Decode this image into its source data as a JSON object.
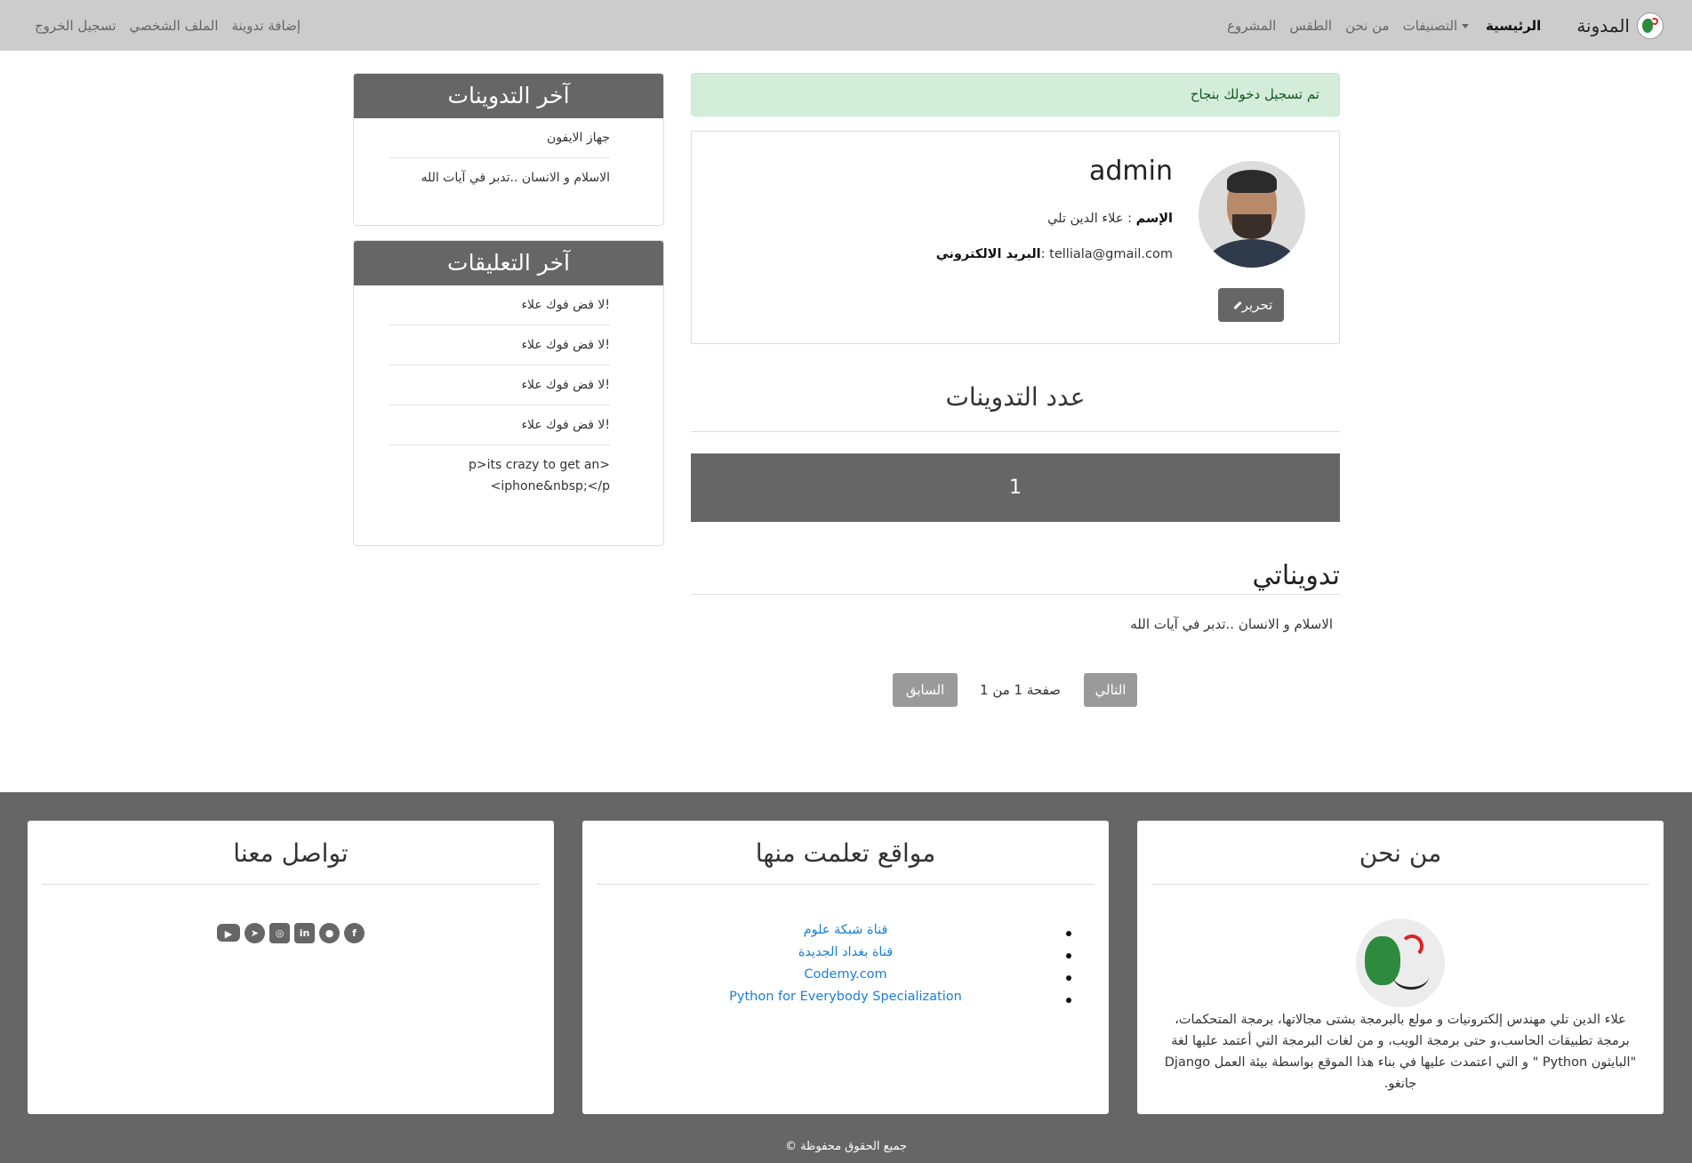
{
  "nav": {
    "brand": "المدونة",
    "home": "الرئيسية",
    "categories": "التصنيفات",
    "about": "من نحن",
    "weather": "الطقس",
    "project": "المشروع",
    "add_post": "إضافة تدوينة",
    "profile": "الملف الشخصي",
    "logout": "تسجيل الخروج"
  },
  "sidebar": {
    "recent_posts_title": "آخر التدوينات",
    "recent_posts": [
      "جهاز الايفون",
      "الاسلام و الانسان ..تدبر في آيات الله"
    ],
    "recent_comments_title": "آخر التعليقات",
    "recent_comments": [
      "لا فض فوك علاء!",
      "لا فض فوك علاء!",
      "لا فض فوك علاء!",
      "لا فض فوك علاء!",
      "p>its crazy to get an> <iphone&nbsp;</p"
    ]
  },
  "alert": "تم تسجيل دخولك بنجاح",
  "profile": {
    "username": "admin",
    "name_label": "الإسم",
    "name_value": "علاء الدين تلي",
    "email_label": "البريد الالكتروني",
    "email_value": "telliala@gmail.com",
    "edit_label": "تحرير"
  },
  "stats": {
    "title": "عدد التدوينات",
    "count": "1"
  },
  "my_posts": {
    "title": "تدويناتي",
    "items": [
      "الاسلام و الانسان ..تدبر في آيات الله"
    ]
  },
  "pagination": {
    "next": "التالي",
    "info": "صفحة 1 من 1",
    "prev": "السابق"
  },
  "footer": {
    "about_title": "من نحن",
    "about_text": "علاء الدين تلي مهندس إلكترونيات و مولع بالبرمجة بشتى مجالاتها، برمجة المتحكمات، برمجة تطبيقات الحاسب،و حتى برمجة الويب، و من لغات البرمجة التي أعتمد عليها لغة \"البايثون Python \" و التي اعتمدت عليها في بناء هذا الموقع بواسطة بيئة العمل Django جانغو.",
    "learn_title": "مواقع تعلمت منها",
    "learn_links": [
      "قناة شبكة علوم",
      "قناة بغداد الجديدة",
      "Codemy.com",
      "Python for Everybody Specialization"
    ],
    "contact_title": "تواصل معنا",
    "social_icons": [
      "facebook-icon",
      "github-icon",
      "linkedin-icon",
      "instagram-icon",
      "telegram-icon",
      "youtube-icon"
    ],
    "copyright": "© جميع الحقوق محفوظة"
  },
  "colors": {
    "navbar": "#cccccc",
    "dark": "#666666",
    "alert_bg": "#d4edda",
    "link": "#1a7fd4"
  }
}
